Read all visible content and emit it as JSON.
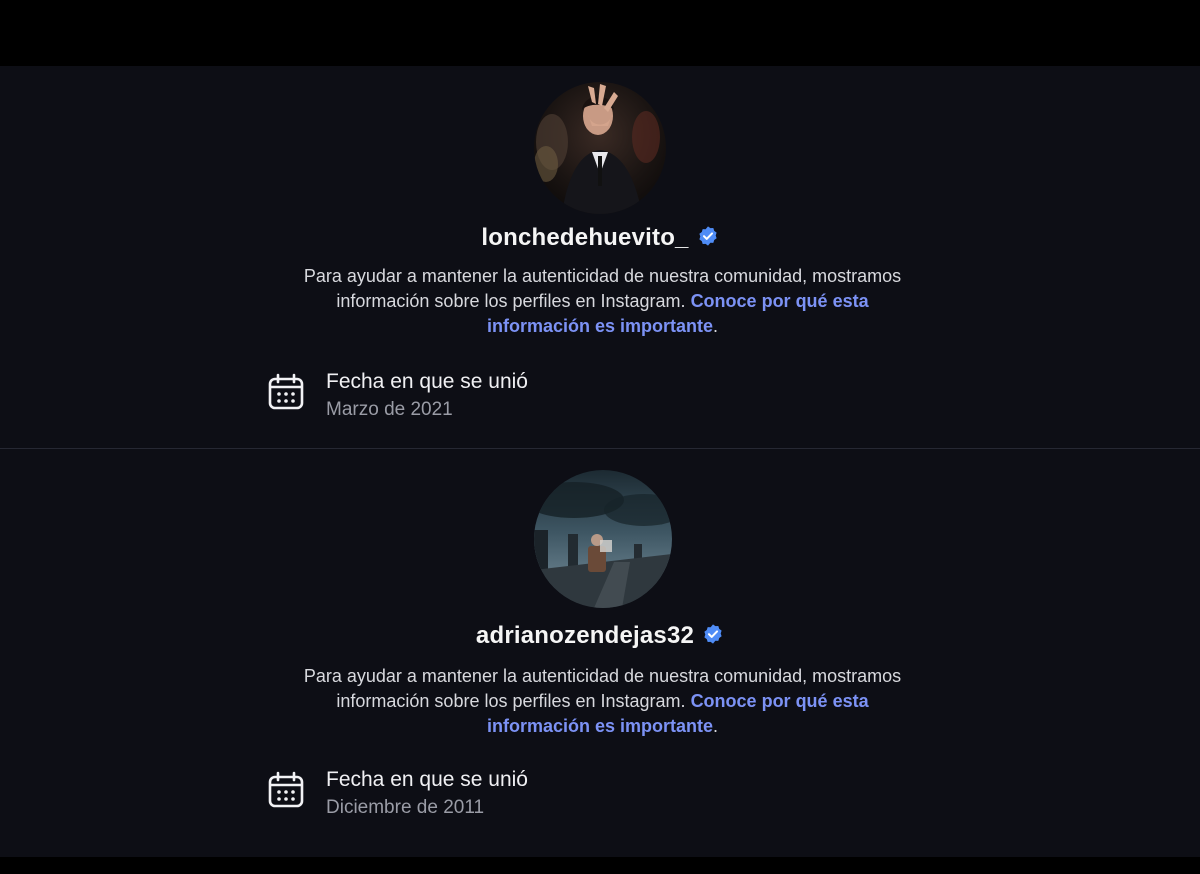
{
  "profiles": [
    {
      "username": "lonchedehuevito_",
      "verified": true,
      "avatar_icon": "profile-photo-man-in-suit",
      "description_text": "Para ayudar a mantener la autenticidad de nuestra comunidad, mostramos información sobre los perfiles en Instagram. ",
      "description_link": "Conoce por qué esta información es importante",
      "description_end": ".",
      "info": {
        "icon": "calendar-icon",
        "label": "Fecha en que se unió",
        "value": "Marzo de 2021"
      }
    },
    {
      "username": "adrianozendejas32",
      "verified": true,
      "avatar_icon": "profile-photo-figure-on-rooftop",
      "description_text": "Para ayudar a mantener la autenticidad de nuestra comunidad, mostramos información sobre los perfiles en Instagram. ",
      "description_link": "Conoce por qué esta información es importante",
      "description_end": ".",
      "info": {
        "icon": "calendar-icon",
        "label": "Fecha en que se unió",
        "value": "Diciembre de 2011"
      }
    }
  ],
  "colors": {
    "background": "#0d0e15",
    "text_primary": "#f5f5f5",
    "text_secondary": "#9a9ca6",
    "link": "#7c92f5",
    "verified_badge": "#4f8cf6"
  }
}
